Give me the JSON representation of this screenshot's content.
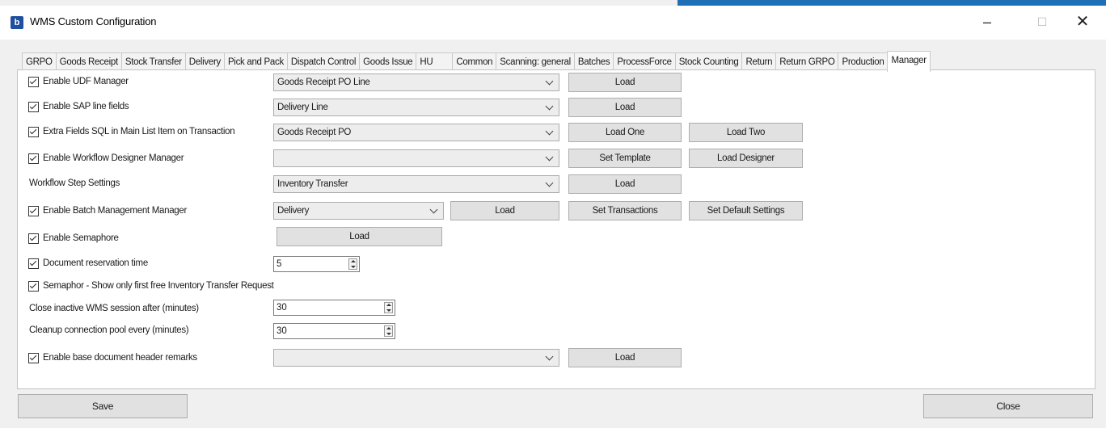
{
  "window": {
    "title": "WMS Custom Configuration",
    "minimize_glyph": "–",
    "maximize_glyph": "☐",
    "close_glyph": "✕",
    "app_icon_glyph": "b"
  },
  "tabs": [
    "GRPO",
    "Goods Receipt",
    "Stock Transfer",
    "Delivery",
    "Pick and Pack",
    "Dispatch Control",
    "Goods Issue",
    "HU",
    "Common",
    "Scanning: general",
    "Batches",
    "ProcessForce",
    "Stock Counting",
    "Return",
    "Return GRPO",
    "Production",
    "Manager"
  ],
  "active_tab": "Manager",
  "rows": {
    "udf": {
      "label": "Enable UDF Manager",
      "checked": true,
      "combo": "Goods Receipt PO Line",
      "btn1": "Load"
    },
    "sap": {
      "label": "Enable SAP line fields",
      "checked": true,
      "combo": "Delivery Line",
      "btn1": "Load"
    },
    "extra": {
      "label": "Extra Fields SQL in Main List Item on Transaction",
      "checked": true,
      "combo": "Goods Receipt PO",
      "btn1": "Load One",
      "btn2": "Load Two"
    },
    "workflow": {
      "label": "Enable Workflow Designer Manager",
      "checked": true,
      "combo": "",
      "btn1": "Set Template",
      "btn2": "Load Designer"
    },
    "step": {
      "label": "Workflow Step Settings",
      "combo": "Inventory Transfer",
      "btn1": "Load"
    },
    "batch": {
      "label": "Enable Batch Management Manager",
      "checked": true,
      "combo": "Delivery",
      "btn1": "Load",
      "btn2": "Set Transactions",
      "btn3": "Set Default Settings"
    },
    "semaphore": {
      "label": "Enable Semaphore",
      "checked": true,
      "btn1": "Load"
    },
    "reservation": {
      "label": "Document reservation time",
      "checked": true,
      "value": "5"
    },
    "semaphor_first": {
      "label": "Semaphor - Show only first free Inventory Transfer Request",
      "checked": true
    },
    "close_inactive": {
      "label": "Close inactive WMS session after (minutes)",
      "value": "30"
    },
    "cleanup": {
      "label": "Cleanup connection pool every (minutes)",
      "value": "30"
    },
    "remarks": {
      "label": "Enable base document header remarks",
      "checked": true,
      "combo": "",
      "btn1": "Load"
    }
  },
  "footer": {
    "save": "Save",
    "close": "Close"
  },
  "colors": {
    "accent": "#1e6fb5",
    "app_icon": "#1f4fa0"
  }
}
